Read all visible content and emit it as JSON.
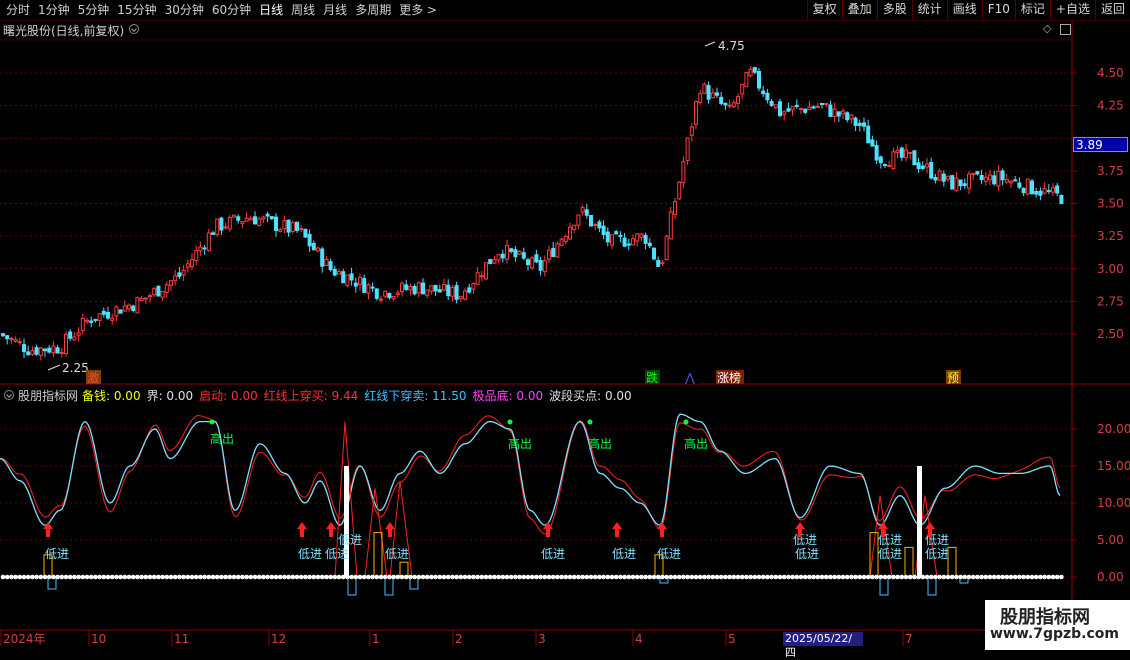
{
  "toolbar": {
    "periods": [
      "分时",
      "1分钟",
      "5分钟",
      "15分钟",
      "30分钟",
      "60分钟",
      "日线",
      "周线",
      "月线",
      "多周期",
      "更多 >"
    ],
    "active": "日线",
    "buttons": [
      "复权",
      "叠加",
      "多股",
      "统计",
      "画线",
      "F10",
      "标记",
      "+自选",
      "返回"
    ]
  },
  "main": {
    "title": "曙光股份(日线,前复权)",
    "price_labels": [
      "4.50",
      "4.25",
      "3.75",
      "3.50",
      "3.25",
      "3.00",
      "2.75",
      "2.50"
    ],
    "price_box": "3.89",
    "hi_label": "4.75",
    "lo_label": "2.25",
    "markers": [
      {
        "text": "激",
        "color": "#ff4040",
        "bg": "#804000"
      },
      {
        "text": "跌",
        "color": "#00ff00",
        "bg": "#004400"
      },
      {
        "text": "⋀",
        "color": "#4060ff",
        "bg": "#000000"
      },
      {
        "text": "涨榜",
        "color": "#ffffff",
        "bg": "#802000"
      },
      {
        "text": "预",
        "color": "#ffff00",
        "bg": "#804000"
      }
    ]
  },
  "indicator": {
    "name": "股朋指标网",
    "fields": [
      {
        "label": "备钱:",
        "value": "0.00",
        "color": "#ffff00"
      },
      {
        "label": "界:",
        "value": "0.00",
        "color": "#e0e0e0"
      },
      {
        "label": "启动:",
        "value": "0.00",
        "color": "#ff3030"
      },
      {
        "label": "红线上穿买:",
        "value": "9.44",
        "color": "#ff3030"
      },
      {
        "label": "红线下穿卖:",
        "value": "11.50",
        "color": "#40c0ff"
      },
      {
        "label": "极品底:",
        "value": "0.00",
        "color": "#ff40ff"
      },
      {
        "label": "波段买点:",
        "value": "0.00",
        "color": "#e0e0e0"
      }
    ],
    "y_labels": [
      "20.00",
      "15.00",
      "10.00",
      "5.00",
      "0.00"
    ],
    "sell_label": "高出",
    "buy_label": "低进"
  },
  "time_axis": [
    "2024年",
    "10",
    "11",
    "12",
    "1",
    "2",
    "3",
    "4",
    "5",
    "7"
  ],
  "cursor_date": "2025/05/22/四",
  "watermark": {
    "title": "股朋指标网",
    "url": "www.7gpzb.com"
  }
}
